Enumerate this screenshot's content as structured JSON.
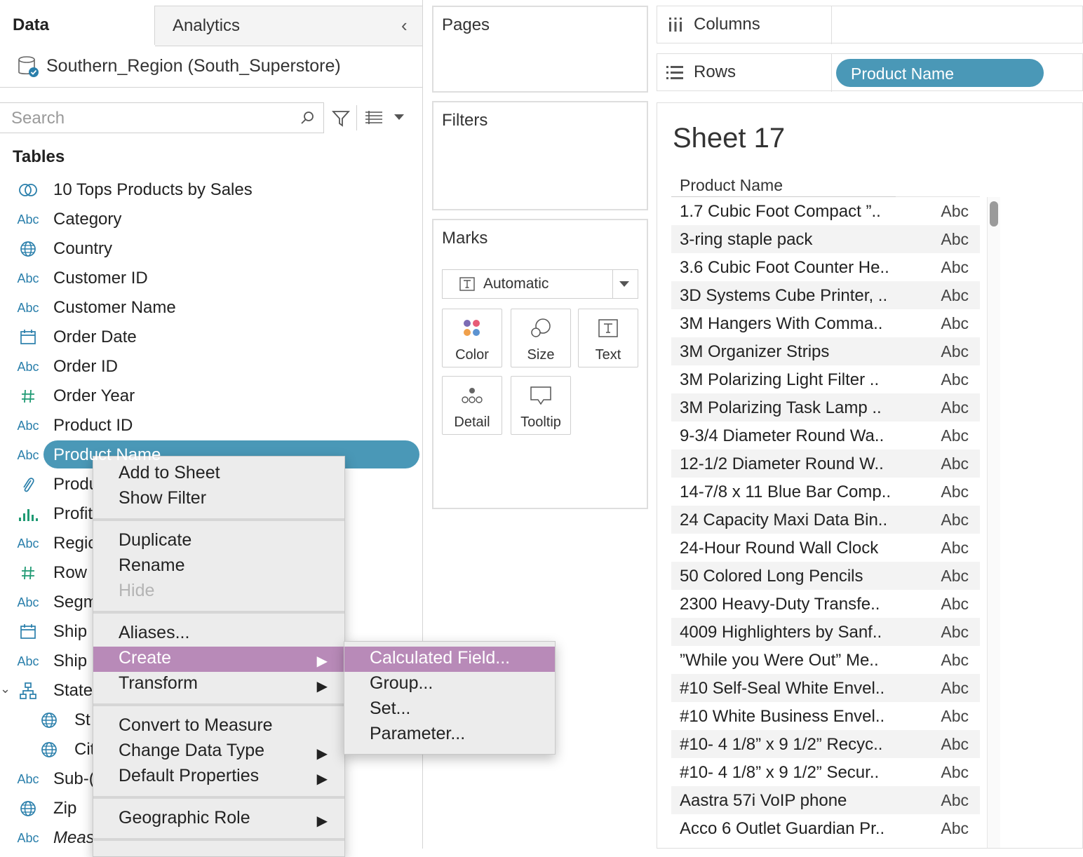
{
  "data_pane": {
    "tab_data": "Data",
    "tab_analytics": "Analytics",
    "datasource": "Southern_Region (South_Superstore)",
    "search_placeholder": "Search",
    "tables_header": "Tables",
    "fields": [
      {
        "icon": "venn-icon",
        "label": "10 Tops Products by Sales"
      },
      {
        "icon": "abc-icon",
        "label": "Category"
      },
      {
        "icon": "globe-icon",
        "label": "Country"
      },
      {
        "icon": "abc-icon",
        "label": "Customer ID"
      },
      {
        "icon": "abc-icon",
        "label": "Customer Name"
      },
      {
        "icon": "calendar-icon",
        "label": "Order Date"
      },
      {
        "icon": "abc-icon",
        "label": "Order ID"
      },
      {
        "icon": "hash-icon",
        "label": "Order Year"
      },
      {
        "icon": "abc-icon",
        "label": "Product ID"
      },
      {
        "icon": "abc-icon",
        "label": "Product Name"
      },
      {
        "icon": "paperclip-icon",
        "label": "Produ"
      },
      {
        "icon": "bar-chart-icon",
        "label": "Profit"
      },
      {
        "icon": "abc-icon",
        "label": "Regic"
      },
      {
        "icon": "hash-icon",
        "label": "Row I"
      },
      {
        "icon": "abc-icon",
        "label": "Segm"
      },
      {
        "icon": "calendar-icon",
        "label": "Ship"
      },
      {
        "icon": "abc-icon",
        "label": "Ship"
      },
      {
        "icon": "hierarchy-icon",
        "label": "State"
      },
      {
        "icon": "globe-icon",
        "label": "St"
      },
      {
        "icon": "globe-icon",
        "label": "Cit"
      },
      {
        "icon": "abc-icon",
        "label": "Sub-("
      },
      {
        "icon": "globe-icon",
        "label": "Zip"
      },
      {
        "icon": "abc-icon",
        "label": "Meas"
      }
    ],
    "abc_text": "Abc"
  },
  "cards": {
    "pages": "Pages",
    "filters": "Filters",
    "marks": "Marks",
    "mark_type": "Automatic",
    "mark_buttons": [
      "Color",
      "Size",
      "Text",
      "Detail",
      "Tooltip"
    ]
  },
  "shelves": {
    "columns": "Columns",
    "rows": "Rows",
    "rows_pill": "Product Name"
  },
  "sheet": {
    "title": "Sheet 17",
    "column_header": "Product Name",
    "abc": "Abc",
    "rows": [
      "1.7 Cubic Foot Compact ”..",
      "3-ring staple pack",
      "3.6 Cubic Foot Counter He..",
      "3D Systems Cube Printer, ..",
      "3M Hangers With Comma..",
      "3M Organizer Strips",
      "3M Polarizing Light Filter ..",
      "3M Polarizing Task Lamp ..",
      "9-3/4 Diameter Round Wa..",
      "12-1/2 Diameter Round W..",
      "14-7/8 x 11 Blue Bar Comp..",
      "24 Capacity Maxi Data Bin..",
      "24-Hour Round Wall Clock",
      "50 Colored Long Pencils",
      "2300 Heavy-Duty Transfe..",
      "4009 Highlighters by Sanf..",
      "”While you Were Out” Me..",
      "#10 Self-Seal White Envel..",
      "#10 White Business Envel..",
      "#10- 4 1/8” x 9 1/2” Recyc..",
      "#10- 4 1/8” x 9 1/2” Secur..",
      "Aastra 57i VoIP phone",
      "Acco 6 Outlet Guardian Pr.."
    ]
  },
  "context_menu": {
    "items": {
      "add_to_sheet": "Add to Sheet",
      "show_filter": "Show Filter",
      "duplicate": "Duplicate",
      "rename": "Rename",
      "hide": "Hide",
      "aliases": "Aliases...",
      "create": "Create",
      "transform": "Transform",
      "convert_to_measure": "Convert to Measure",
      "change_data_type": "Change Data Type",
      "default_properties": "Default Properties",
      "geographic_role": "Geographic Role"
    },
    "submenu": [
      "Calculated Field...",
      "Group...",
      "Set...",
      "Parameter..."
    ]
  },
  "colors": {
    "accent_pill": "#4a98b7",
    "menu_highlight": "#b88ab8",
    "field_icon": "#2a7fab"
  }
}
